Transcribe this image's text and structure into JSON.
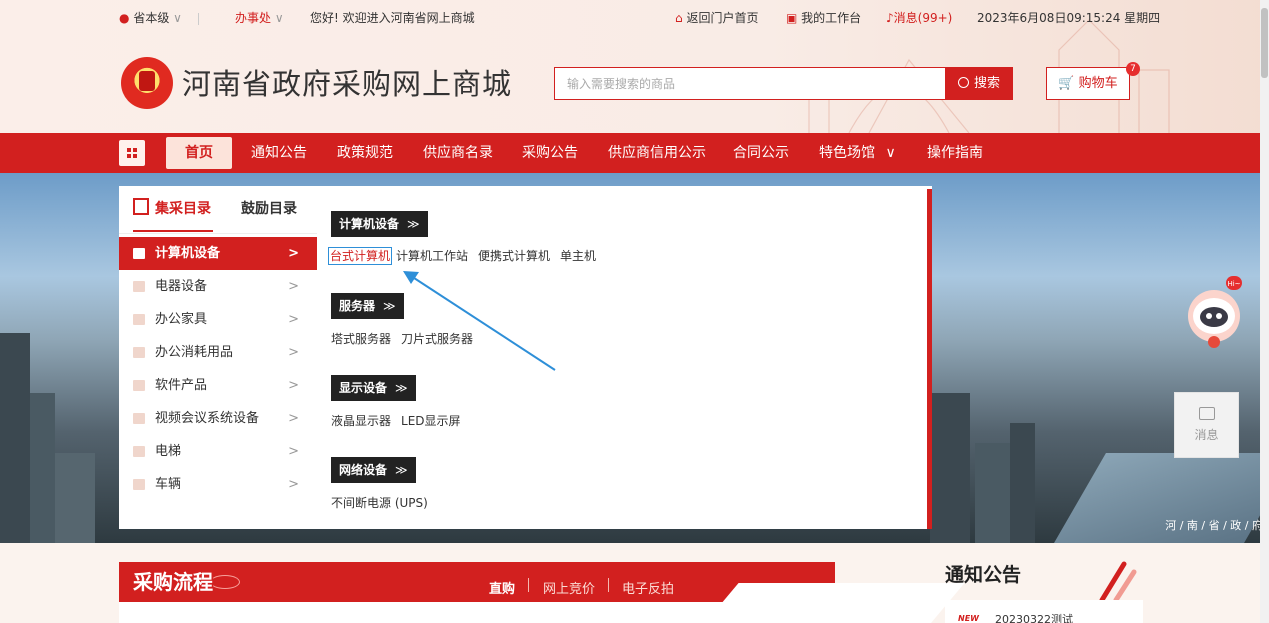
{
  "topbar": {
    "location": "省本级",
    "office": "办事处",
    "welcome": "您好! 欢迎进入河南省网上商城",
    "portal_home": "返回门户首页",
    "workbench": "我的工作台",
    "messages": "消息(99+)",
    "datetime": "2023年6月08日09:15:24 星期四"
  },
  "header": {
    "title": "河南省政府采购网上商城",
    "search_placeholder": "输入需要搜索的商品",
    "search_button": "搜索",
    "cart_label": "购物车",
    "cart_count": "7"
  },
  "nav": {
    "items": [
      "首页",
      "通知公告",
      "政策规范",
      "供应商名录",
      "采购公告",
      "供应商信用公示",
      "合同公示",
      "特色场馆",
      "操作指南"
    ]
  },
  "category": {
    "tab_active": "集采目录",
    "tab_other": "鼓励目录",
    "items": [
      "计算机设备",
      "电器设备",
      "办公家具",
      "办公消耗用品",
      "软件产品",
      "视频会议系统设备",
      "电梯",
      "车辆"
    ]
  },
  "dropdown": {
    "groups": [
      {
        "title": "计算机设备",
        "links": [
          "台式计算机",
          "计算机工作站",
          "便携式计算机",
          "单主机"
        ]
      },
      {
        "title": "服务器",
        "links": [
          "塔式服务器",
          "刀片式服务器"
        ]
      },
      {
        "title": "显示设备",
        "links": [
          "液晶显示器",
          "LED显示屏"
        ]
      },
      {
        "title": "网络设备",
        "links": [
          "不间断电源 (UPS)"
        ]
      }
    ]
  },
  "float": {
    "message_label": "消息",
    "robot_badge": "Hi~"
  },
  "banner": {
    "watermark": "河 / 南 / 省 / 政 / 府"
  },
  "process": {
    "title": "采购流程",
    "tabs": [
      "直购",
      "网上竞价",
      "电子反拍"
    ]
  },
  "notice": {
    "title": "通知公告",
    "new_badge": "NEW",
    "first_item": "20230322测试"
  },
  "colors": {
    "brand_red": "#d2201f",
    "highlight_border": "#2e8fd8"
  }
}
